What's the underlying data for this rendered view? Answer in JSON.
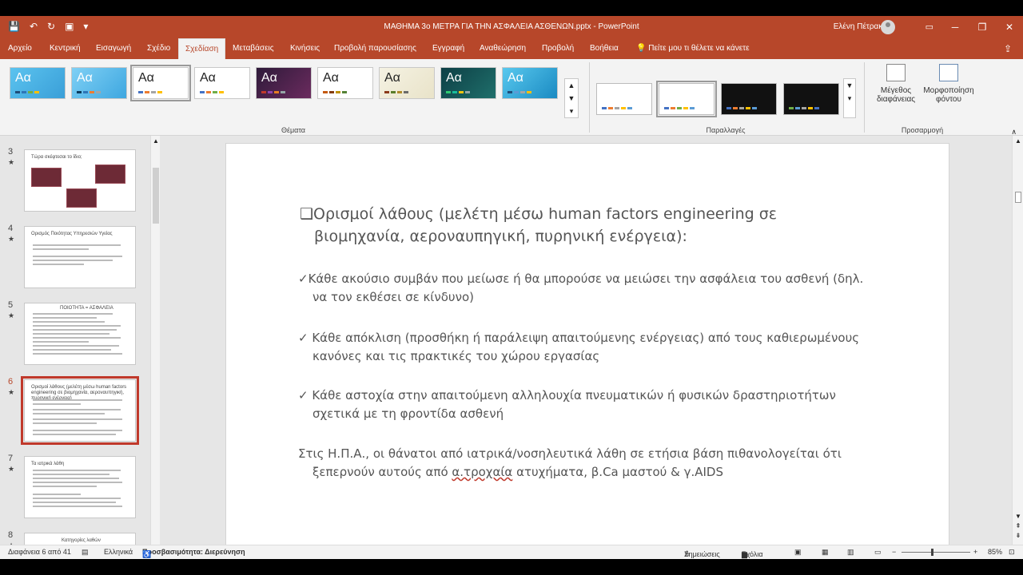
{
  "window": {
    "title": "ΜΑΘΗΜΑ 3ο ΜΕΤΡΑ ΓΙΑ ΤΗΝ ΑΣΦΑΛΕΙΑ ΑΣΘΕΝΩΝ.pptx  -  PowerPoint",
    "user": "Ελένη Πέτρακα"
  },
  "tabs": [
    "Αρχείο",
    "Κεντρική",
    "Εισαγωγή",
    "Σχέδιο",
    "Σχεδίαση",
    "Μεταβάσεις",
    "Κινήσεις",
    "Προβολή παρουσίασης",
    "Εγγραφή",
    "Αναθεώρηση",
    "Προβολή",
    "Βοήθεια"
  ],
  "active_tab": "Σχεδίαση",
  "tell_me": "Πείτε μου τι θέλετε να κάνετε",
  "ribbon": {
    "themes_label": "Θέματα",
    "variants_label": "Παραλλαγές",
    "customize_label": "Προσαρμογή",
    "theme_text": "Aα",
    "slide_size": "Μέγεθος διαφάνειας",
    "format_background": "Μορφοποίηση φόντου"
  },
  "thumbnails": [
    {
      "num": "3",
      "title": "Τώρα σκέφτεσαι το ίδιο;"
    },
    {
      "num": "4",
      "title": "Ορισμός Ποιότητας Υπηρεσιών Υγείας"
    },
    {
      "num": "5",
      "title": "ΠΟΙΟΤΗΤΑ = ΑΣΦΑΛΕΙΑ"
    },
    {
      "num": "6",
      "title": "Ορισμοί λάθους (μελέτη μέσω human factors engineering σε βιομηχανία, αεροναυπηγική, πυρηνική ενέργεια)"
    },
    {
      "num": "7",
      "title": "Τα ιατρικά λάθη"
    },
    {
      "num": "8",
      "title": "Κατηγορίες λαθών"
    }
  ],
  "slide": {
    "title_bullet": "❑",
    "title": "Ορισμοί λάθους (μελέτη μέσω human factors engineering σε βιομηχανία, αεροναυπηγική, πυρηνική ενέργεια):",
    "check": "✓",
    "b1": "Κάθε ακούσιο συμβάν που μείωσε ή θα μπορούσε να μειώσει την ασφάλεια του ασθενή (δηλ. να τον εκθέσει σε κίνδυνο)",
    "b2": " Κάθε απόκλιση (προσθήκη ή παράλειψη απαιτούμενης ενέργειας) από τους καθιερωμένους κανόνες και τις πρακτικές του χώρου εργασίας",
    "b3": " Κάθε αστοχία στην απαιτούμενη αλληλουχία  πνευματικών ή φυσικών δραστηριοτήτων σχετικά με τη φροντίδα ασθενή",
    "b4_pre": "Στις Η.Π.Α., οι θάνατοι από ιατρικά/νοσηλευτικά λάθη σε ετήσια βάση πιθανολογείται ότι ξεπερνούν αυτούς από ",
    "b4_und": "α.τροχαία",
    "b4_post": " ατυχήματα, β.Ca μαστού & γ.AIDS"
  },
  "status": {
    "slide_of": "Διαφάνεια 6 από 41",
    "language": "Ελληνικά",
    "accessibility": "Προσβασιμότητα: Διερεύνηση",
    "notes": "Σημειώσεις",
    "comments": "Σχόλια",
    "zoom": "85%"
  },
  "colors": {
    "accent": "#b7472a",
    "selected_thumb": "#c0392b"
  }
}
